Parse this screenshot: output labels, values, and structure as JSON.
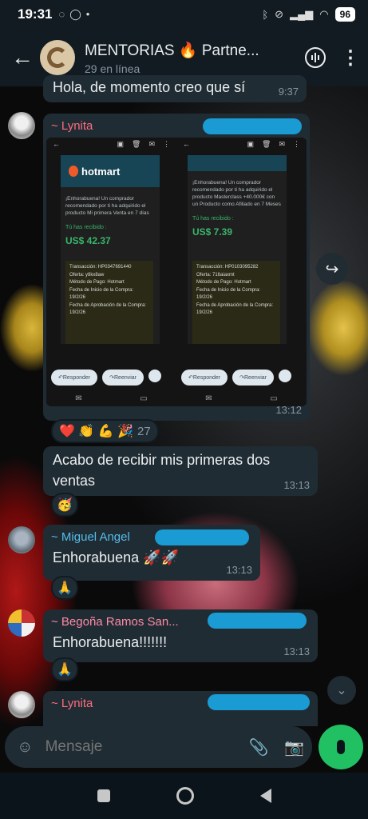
{
  "status": {
    "time": "19:31",
    "battery": "96"
  },
  "header": {
    "title": "MENTORIAS 🔥 Partne...",
    "subtitle": "29 en línea"
  },
  "colors": {
    "lynita": "#ff6b7f",
    "miguel": "#53bdeb",
    "begona": "#ff8aa5",
    "accent": "#21c063",
    "bubble": "#202c33"
  },
  "messages": {
    "top": {
      "text": "Hola, de momento creo que sí",
      "time": "9:37"
    },
    "lynita_image": {
      "sender": "~ Lynita",
      "time": "13:12",
      "reactions": {
        "emojis": "❤️ 👏 💪 🎉",
        "count": "27"
      },
      "shot": {
        "brand": "hotmart",
        "left": {
          "msg": "¡Enhorabuena! Un comprador recomendado por ti ha adquirido el producto Mi primera Venta en 7 días",
          "received": "Tú has recibido :",
          "amount": "US$ 42.37",
          "tx": [
            "Transacción: HP0347691440",
            "Oferta: y8kx8aw",
            "Método de Pago: Hotmart",
            "Fecha de Inicio de la Compra: 19/2/26",
            "Fecha de Aprobación de la Compra: 19/2/26"
          ]
        },
        "right": {
          "msg": "¡Enhorabuena! Un comprador recomendado por ti ha adquirido el producto Masterclass +40.000€ con un Producto como Afiliado en 7 Meses",
          "received": "Tú has recibido :",
          "amount": "US$ 7.39",
          "tx": [
            "Transacción: HP0103095282",
            "Oferta: 716aiaxmt",
            "Método de Pago: Hotmart",
            "Fecha de Inicio de la Compra: 19/2/26",
            "Fecha de Aprobación de la Compra: 19/2/26"
          ]
        },
        "reply": "Responder",
        "forward": "Reenviar"
      }
    },
    "lynita_text": {
      "text": "Acabo de recibir mis primeras dos ventas",
      "time": "13:13",
      "reaction": "🥳"
    },
    "miguel": {
      "sender": "~ Miguel Angel",
      "text": "Enhorabuena 🚀🚀",
      "time": "13:13",
      "reaction": "🙏"
    },
    "begona": {
      "sender": "~ Begoña Ramos San...",
      "text": "Enhorabuena!!!!!!!",
      "time": "13:13",
      "reaction": "🙏"
    },
    "lynita_last": {
      "sender": "~ Lynita"
    }
  },
  "input": {
    "placeholder": "Mensaje"
  }
}
